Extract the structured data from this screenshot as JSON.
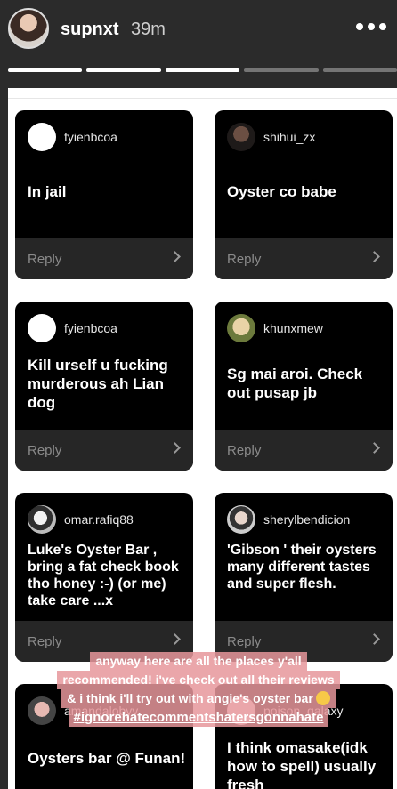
{
  "story": {
    "username": "supnxt",
    "time_ago": "39m",
    "segments_total": 5,
    "segments_viewed": 3
  },
  "cards": [
    {
      "handle": "fyienbcoa",
      "message": "In jail",
      "reply": "Reply"
    },
    {
      "handle": "shihui_zx",
      "message": "Oyster co babe",
      "reply": "Reply"
    },
    {
      "handle": "fyienbcoa",
      "message": "Kill urself u fucking murderous ah Lian dog",
      "reply": "Reply"
    },
    {
      "handle": "khunxmew",
      "message": "Sg mai aroi. Check out pusap jb",
      "reply": "Reply"
    },
    {
      "handle": "omar.rafiq88",
      "message": "Luke's Oyster Bar , bring a fat check book tho honey :-) (or me) take care ...x",
      "reply": "Reply"
    },
    {
      "handle": "sherylbendicion",
      "message": "'Gibson '  their oysters many different tastes and super flesh.",
      "reply": "Reply"
    },
    {
      "handle": "amandalobyy",
      "message": "Oysters bar @ Funan!",
      "reply": ""
    },
    {
      "handle": "poison_galaxy",
      "message": "I think omasake(idk how to spell) usually fresh",
      "reply": ""
    }
  ],
  "caption": {
    "line1": "anyway here are all the places y'all",
    "line2": "recommended! i've check out all their reviews",
    "line3": "& i think i'll try out with angie's oyster bar",
    "hashtag": "#ignorehatecommentshatersgonnahate"
  }
}
